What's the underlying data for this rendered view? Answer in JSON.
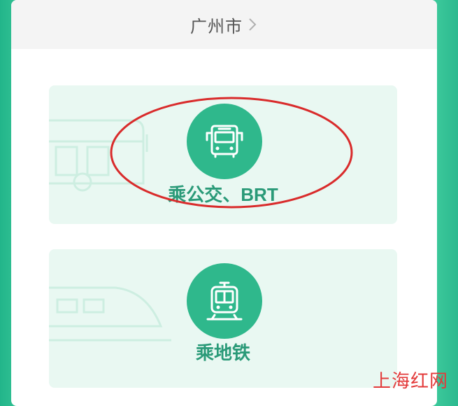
{
  "header": {
    "city": "广州市"
  },
  "options": [
    {
      "label": "乘公交、BRT",
      "icon": "bus-icon"
    },
    {
      "label": "乘地铁",
      "icon": "metro-icon"
    }
  ],
  "watermark": "上海红网",
  "colors": {
    "accent": "#2fb88c",
    "label": "#2a9a78",
    "option_bg": "#e9f8f2",
    "annotation": "#d92b2b",
    "watermark": "#e33a3a"
  }
}
